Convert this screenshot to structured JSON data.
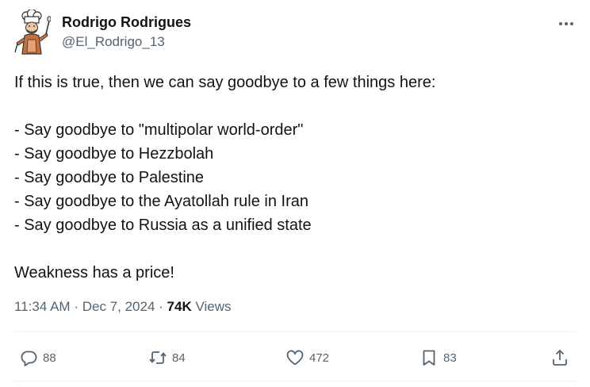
{
  "author": {
    "name": "Rodrigo Rodrigues",
    "handle": "@El_Rodrigo_13"
  },
  "more_icon": "more-horizontal-icon",
  "tweet": {
    "lines": [
      "If this is true, then we can say goodbye to a few things here:",
      "- Say goodbye to \"multipolar world-order\"",
      "- Say goodbye to Hezzbolah",
      "- Say goodbye to Palestine",
      "- Say goodbye to the Ayatollah rule in Iran",
      "- Say goodbye to Russia as a unified state",
      "Weakness has a price!"
    ]
  },
  "meta": {
    "time": "11:34 AM",
    "separator": "·",
    "date": "Dec 7, 2024",
    "views_count": "74K",
    "views_label": "Views"
  },
  "actions": {
    "reply": {
      "icon": "reply-icon",
      "count": "88"
    },
    "repost": {
      "icon": "repost-icon",
      "count": "84"
    },
    "like": {
      "icon": "heart-icon",
      "count": "472"
    },
    "bookmark": {
      "icon": "bookmark-icon",
      "count": "83"
    },
    "share": {
      "icon": "share-icon"
    }
  },
  "colors": {
    "text_primary": "#0f1419",
    "text_secondary": "#536471",
    "divider": "#eff3f4"
  }
}
